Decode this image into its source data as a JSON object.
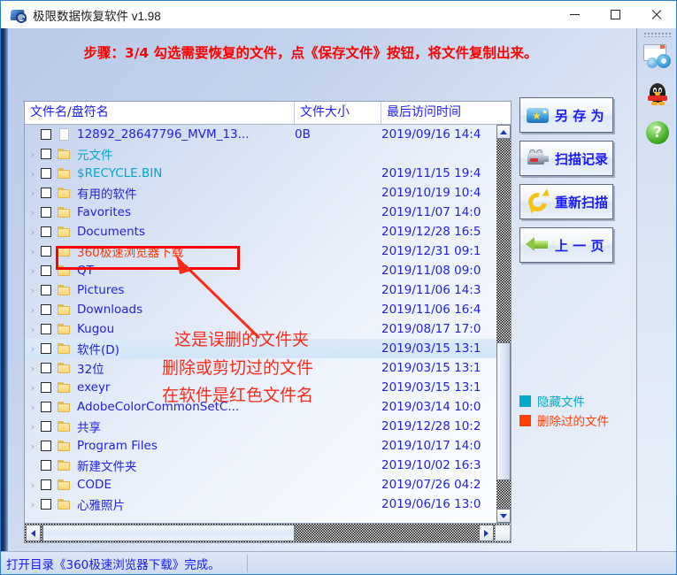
{
  "window": {
    "title": "极限数据恢复软件 v1.98",
    "icon": "disk-magnifier-icon",
    "minimize_label": "最小化",
    "maximize_label": "最大化",
    "close_label": "关闭"
  },
  "banner": {
    "text": "步骤：3/4 勾选需要恢复的文件，点《保存文件》按钮，将文件复制出来。",
    "color": "#ff0000"
  },
  "file_list": {
    "columns": [
      "文件名/盘符名",
      "文件大小",
      "最后访问时间"
    ],
    "rows": [
      {
        "name": "12892_28647796_MVM_13...",
        "size": "0B",
        "date": "2019/09/16 14:4",
        "type": "file",
        "kind": "normal",
        "expandable": false,
        "checked": false,
        "selected": false
      },
      {
        "name": "元文件",
        "size": "",
        "date": "",
        "type": "folder",
        "kind": "hidden",
        "expandable": true,
        "checked": false,
        "selected": false
      },
      {
        "name": "$RECYCLE.BIN",
        "size": "",
        "date": "2019/11/15 19:4",
        "type": "folder",
        "kind": "hidden",
        "expandable": true,
        "checked": false,
        "selected": false
      },
      {
        "name": "有用的软件",
        "size": "",
        "date": "2019/10/19 10:4",
        "type": "folder",
        "kind": "normal",
        "expandable": true,
        "checked": false,
        "selected": false
      },
      {
        "name": "Favorites",
        "size": "",
        "date": "2019/11/07 14:0",
        "type": "folder",
        "kind": "normal",
        "expandable": true,
        "checked": false,
        "selected": false
      },
      {
        "name": "Documents",
        "size": "",
        "date": "2019/12/28 16:5",
        "type": "folder",
        "kind": "normal",
        "expandable": true,
        "checked": false,
        "selected": false
      },
      {
        "name": "360极速浏览器下载",
        "size": "",
        "date": "2019/12/31 09:1",
        "type": "folder",
        "kind": "deleted",
        "expandable": true,
        "checked": false,
        "selected": false
      },
      {
        "name": "QT",
        "size": "",
        "date": "2019/11/08 09:0",
        "type": "folder",
        "kind": "normal",
        "expandable": true,
        "checked": false,
        "selected": false
      },
      {
        "name": "Pictures",
        "size": "",
        "date": "2019/11/06 14:3",
        "type": "folder",
        "kind": "normal",
        "expandable": true,
        "checked": false,
        "selected": false
      },
      {
        "name": "Downloads",
        "size": "",
        "date": "2019/11/06 16:4",
        "type": "folder",
        "kind": "normal",
        "expandable": true,
        "checked": false,
        "selected": false
      },
      {
        "name": "Kugou",
        "size": "",
        "date": "2019/08/17 17:0",
        "type": "folder",
        "kind": "normal",
        "expandable": true,
        "checked": false,
        "selected": false
      },
      {
        "name": "软件(D)",
        "size": "",
        "date": "2019/03/15 13:1",
        "type": "folder",
        "kind": "normal",
        "expandable": true,
        "checked": false,
        "selected": true
      },
      {
        "name": "32位",
        "size": "",
        "date": "2019/03/15 13:1",
        "type": "folder",
        "kind": "normal",
        "expandable": true,
        "checked": false,
        "selected": false
      },
      {
        "name": "exeyr",
        "size": "",
        "date": "2019/03/15 13:1",
        "type": "folder",
        "kind": "normal",
        "expandable": true,
        "checked": false,
        "selected": false
      },
      {
        "name": "AdobeColorCommonSetC...",
        "size": "",
        "date": "2019/03/14 10:0",
        "type": "folder",
        "kind": "normal",
        "expandable": true,
        "checked": false,
        "selected": false
      },
      {
        "name": "共享",
        "size": "",
        "date": "2019/12/28 10:2",
        "type": "folder",
        "kind": "normal",
        "expandable": true,
        "checked": false,
        "selected": false
      },
      {
        "name": "Program Files",
        "size": "",
        "date": "2019/10/17 14:0",
        "type": "folder",
        "kind": "normal",
        "expandable": true,
        "checked": false,
        "selected": false
      },
      {
        "name": "新建文件夹",
        "size": "",
        "date": "2019/10/02 16:3",
        "type": "folder",
        "kind": "normal",
        "expandable": false,
        "checked": false,
        "selected": false
      },
      {
        "name": "CODE",
        "size": "",
        "date": "2019/07/26 04:2",
        "type": "folder",
        "kind": "normal",
        "expandable": true,
        "checked": false,
        "selected": false
      },
      {
        "name": "心雅照片",
        "size": "",
        "date": "2019/06/16 13:0",
        "type": "folder",
        "kind": "normal",
        "expandable": true,
        "checked": false,
        "selected": false
      }
    ],
    "sort_marker": "⌄"
  },
  "buttons": [
    {
      "label": "另 存 为",
      "icon": "save-as-icon"
    },
    {
      "label": "扫描记录",
      "icon": "camera-icon"
    },
    {
      "label": "重新扫描",
      "icon": "refresh-icon"
    },
    {
      "label": "上 一 页",
      "icon": "back-arrow-icon"
    }
  ],
  "legend": [
    {
      "label": "隐藏文件",
      "color": "#00a9c8"
    },
    {
      "label": "删除过的文件",
      "color": "#ff4000"
    }
  ],
  "annotations": {
    "line1": "这是误删的文件夹",
    "line2": "删除或剪切过的文件",
    "line3": "在软件是红色文件名",
    "color": "#fe2b1a",
    "highlight_box_color": "#fe0000"
  },
  "status": {
    "text": "打开目录《360极速浏览器下载》完成。"
  },
  "dock": [
    {
      "icon": "window-settings-icon",
      "label": "设置"
    },
    {
      "icon": "qq-penguin-icon",
      "label": "QQ"
    },
    {
      "icon": "help-question-icon",
      "label": "帮助"
    }
  ],
  "scrollbars": {
    "up_arrow": "▲",
    "down_arrow": "▼",
    "left_arrow": "◀",
    "right_arrow": "▶"
  }
}
